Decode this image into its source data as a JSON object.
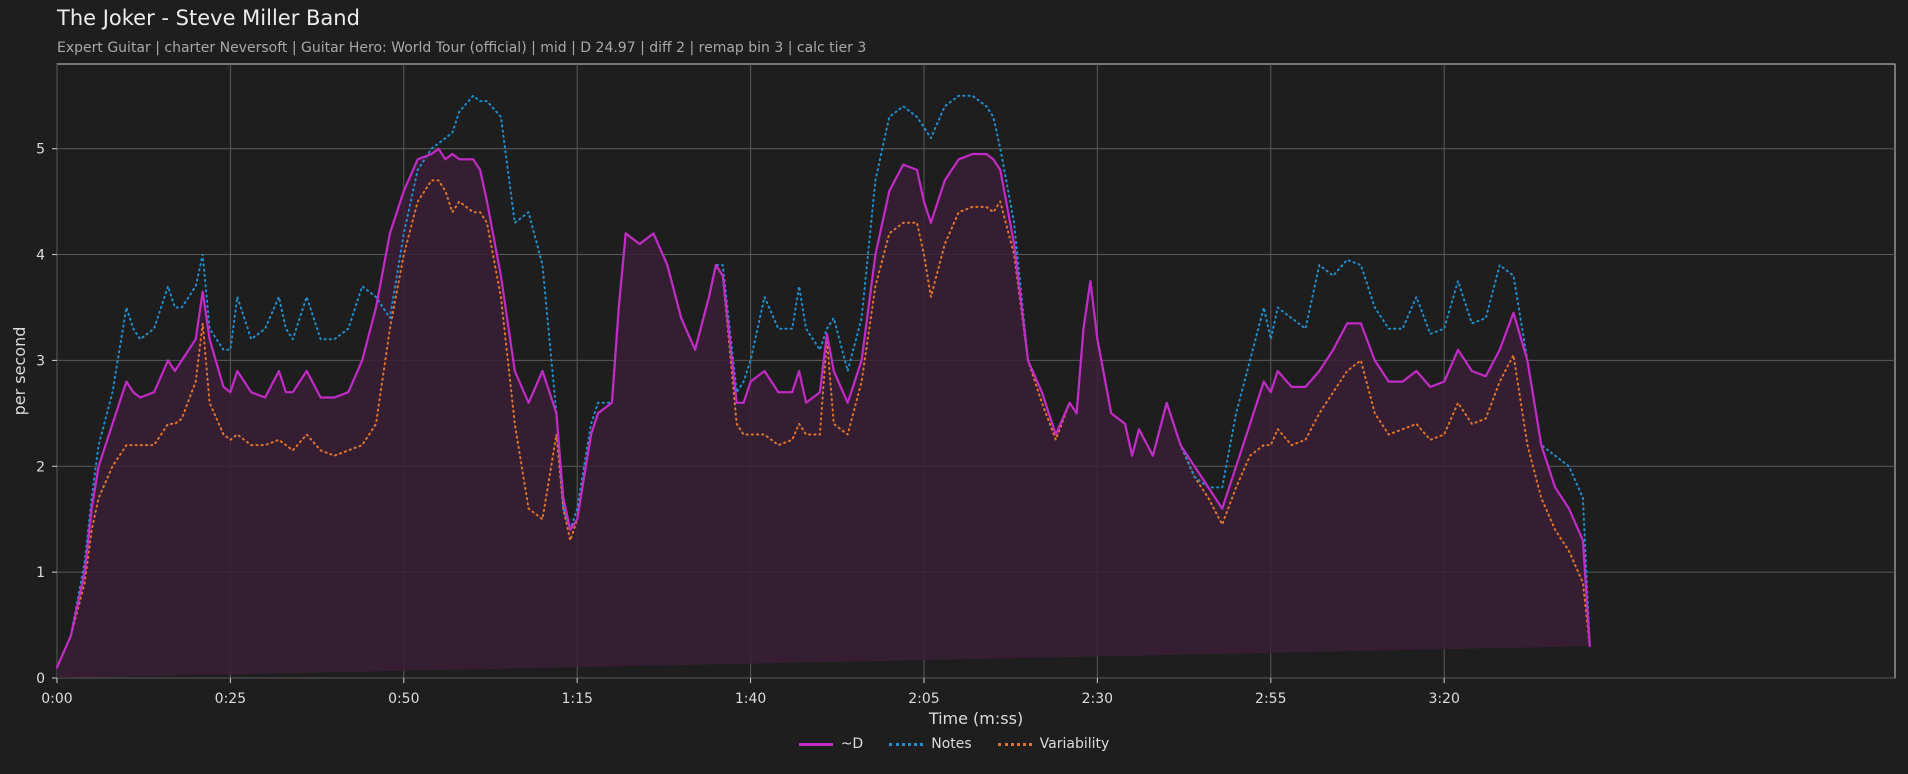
{
  "title": "The Joker - Steve Miller Band",
  "subtitle": "Expert Guitar  |  charter Neversoft  |  Guitar Hero: World Tour (official)  |  mid  |  D 24.97  |  diff 2  |  remap bin 3  |  calc tier 3",
  "colors": {
    "d": "#c22bc7",
    "notes": "#1f8fd0",
    "variability": "#e0752a",
    "fill": "#3a1f36",
    "grid": "#5a5a5a",
    "background": "#1e1e1e"
  },
  "chart_data": {
    "type": "line",
    "xlabel": "Time (m:ss)",
    "ylabel": "per second",
    "xlim": [
      0,
      265
    ],
    "ylim": [
      0,
      5.8
    ],
    "x_ticks": [
      0,
      25,
      50,
      75,
      100,
      125,
      150,
      175,
      200
    ],
    "x_tick_labels": [
      "0:00",
      "0:25",
      "0:50",
      "1:15",
      "1:40",
      "2:05",
      "2:30",
      "2:55",
      "3:20"
    ],
    "y_ticks": [
      0,
      1,
      2,
      3,
      4,
      5
    ],
    "y_tick_labels": [
      "0",
      "1",
      "2",
      "3",
      "4",
      "5"
    ],
    "grid": true,
    "legend_position": "bottom-center",
    "x": [
      0,
      2,
      4,
      5,
      6,
      8,
      10,
      11,
      12,
      14,
      16,
      17,
      18,
      20,
      21,
      22,
      24,
      25,
      26,
      28,
      30,
      32,
      33,
      34,
      36,
      38,
      40,
      42,
      44,
      46,
      48,
      50,
      52,
      54,
      55,
      56,
      57,
      58,
      60,
      61,
      62,
      64,
      66,
      68,
      70,
      72,
      73,
      74,
      75,
      76,
      77,
      78,
      80,
      81,
      82,
      84,
      86,
      88,
      90,
      92,
      94,
      95,
      96,
      98,
      99,
      100,
      102,
      104,
      106,
      107,
      108,
      110,
      111,
      112,
      114,
      116,
      118,
      120,
      122,
      124,
      125,
      126,
      128,
      130,
      132,
      134,
      135,
      136,
      138,
      140,
      142,
      144,
      146,
      147,
      148,
      149,
      150,
      152,
      154,
      155,
      156,
      158,
      160,
      162,
      164,
      166,
      168,
      170,
      172,
      174,
      175,
      176,
      178,
      180,
      182,
      184,
      186,
      188,
      190,
      192,
      194,
      196,
      198,
      200,
      202,
      204,
      206,
      208,
      210,
      212,
      214,
      216,
      218,
      220,
      221,
      222,
      223,
      224,
      226
    ],
    "series": [
      {
        "name": "~D",
        "style": "solid",
        "values": [
          0.1,
          0.4,
          1.0,
          1.6,
          2.0,
          2.4,
          2.8,
          2.7,
          2.65,
          2.7,
          3.0,
          2.9,
          3.0,
          3.2,
          3.65,
          3.2,
          2.75,
          2.7,
          2.9,
          2.7,
          2.65,
          2.9,
          2.7,
          2.7,
          2.9,
          2.65,
          2.65,
          2.7,
          3.0,
          3.5,
          4.2,
          4.6,
          4.9,
          4.95,
          5.0,
          4.9,
          4.95,
          4.9,
          4.9,
          4.8,
          4.5,
          3.8,
          2.9,
          2.6,
          2.9,
          2.5,
          1.7,
          1.4,
          1.5,
          1.9,
          2.3,
          2.5,
          2.6,
          3.5,
          4.2,
          4.1,
          4.2,
          3.9,
          3.4,
          3.1,
          3.6,
          3.9,
          3.8,
          2.6,
          2.6,
          2.8,
          2.9,
          2.7,
          2.7,
          2.9,
          2.6,
          2.7,
          3.25,
          2.9,
          2.6,
          3.0,
          4.0,
          4.6,
          4.85,
          4.8,
          4.5,
          4.3,
          4.7,
          4.9,
          4.95,
          4.95,
          4.9,
          4.8,
          4.1,
          3.0,
          2.7,
          2.3,
          2.6,
          2.5,
          3.3,
          3.75,
          3.2,
          2.5,
          2.4,
          2.1,
          2.35,
          2.1,
          2.6,
          2.2,
          2.0,
          1.8,
          1.6,
          2.0,
          2.4,
          2.8,
          2.7,
          2.9,
          2.75,
          2.75,
          2.9,
          3.1,
          3.35,
          3.35,
          3.0,
          2.8,
          2.8,
          2.9,
          2.75,
          2.8,
          3.1,
          2.9,
          2.85,
          3.1,
          3.45,
          3.0,
          2.2,
          1.8,
          1.6,
          1.3,
          0.3
        ]
      },
      {
        "name": "Notes",
        "style": "dotted",
        "values": [
          0.1,
          0.4,
          1.1,
          1.7,
          2.2,
          2.7,
          3.5,
          3.3,
          3.2,
          3.3,
          3.7,
          3.5,
          3.5,
          3.7,
          4.0,
          3.3,
          3.1,
          3.1,
          3.6,
          3.2,
          3.3,
          3.6,
          3.3,
          3.2,
          3.6,
          3.2,
          3.2,
          3.3,
          3.7,
          3.6,
          3.4,
          4.2,
          4.8,
          5.0,
          5.05,
          5.1,
          5.15,
          5.35,
          5.5,
          5.45,
          5.45,
          5.3,
          4.3,
          4.4,
          3.9,
          2.5,
          1.6,
          1.4,
          1.6,
          2.0,
          2.4,
          2.6,
          2.6,
          3.5,
          4.2,
          4.1,
          4.2,
          3.9,
          3.4,
          3.1,
          3.6,
          3.9,
          3.9,
          2.7,
          2.8,
          3.0,
          3.6,
          3.3,
          3.3,
          3.7,
          3.3,
          3.1,
          3.3,
          3.4,
          2.9,
          3.4,
          4.7,
          5.3,
          5.4,
          5.3,
          5.2,
          5.1,
          5.4,
          5.5,
          5.5,
          5.4,
          5.3,
          5.0,
          4.3,
          3.0,
          2.7,
          2.3,
          2.6,
          2.5,
          3.3,
          3.75,
          3.2,
          2.5,
          2.4,
          2.1,
          2.35,
          2.1,
          2.6,
          2.2,
          1.9,
          1.8,
          1.8,
          2.5,
          3.0,
          3.5,
          3.2,
          3.5,
          3.4,
          3.3,
          3.9,
          3.8,
          3.95,
          3.9,
          3.5,
          3.3,
          3.3,
          3.6,
          3.25,
          3.3,
          3.75,
          3.35,
          3.4,
          3.9,
          3.8,
          3.0,
          2.2,
          2.1,
          2.0,
          1.7,
          0.3
        ]
      },
      {
        "name": "Variability",
        "style": "dotted",
        "values": [
          0.1,
          0.4,
          0.9,
          1.4,
          1.7,
          2.0,
          2.2,
          2.2,
          2.2,
          2.2,
          2.4,
          2.4,
          2.45,
          2.8,
          3.35,
          2.6,
          2.3,
          2.25,
          2.3,
          2.2,
          2.2,
          2.25,
          2.2,
          2.15,
          2.3,
          2.15,
          2.1,
          2.15,
          2.2,
          2.4,
          3.3,
          4.0,
          4.5,
          4.7,
          4.7,
          4.6,
          4.4,
          4.5,
          4.4,
          4.4,
          4.3,
          3.6,
          2.4,
          1.6,
          1.5,
          2.3,
          1.6,
          1.3,
          1.5,
          1.9,
          2.3,
          2.5,
          2.6,
          3.5,
          4.2,
          4.1,
          4.2,
          3.9,
          3.4,
          3.1,
          3.6,
          3.9,
          3.8,
          2.4,
          2.3,
          2.3,
          2.3,
          2.2,
          2.25,
          2.4,
          2.3,
          2.3,
          3.2,
          2.4,
          2.3,
          2.8,
          3.7,
          4.2,
          4.3,
          4.3,
          4.0,
          3.6,
          4.1,
          4.4,
          4.45,
          4.45,
          4.4,
          4.5,
          4.0,
          3.0,
          2.6,
          2.25,
          2.6,
          2.5,
          3.3,
          3.75,
          3.2,
          2.5,
          2.4,
          2.1,
          2.35,
          2.1,
          2.6,
          2.2,
          1.9,
          1.7,
          1.45,
          1.8,
          2.1,
          2.2,
          2.2,
          2.35,
          2.2,
          2.25,
          2.5,
          2.7,
          2.9,
          3.0,
          2.5,
          2.3,
          2.35,
          2.4,
          2.25,
          2.3,
          2.6,
          2.4,
          2.45,
          2.8,
          3.05,
          2.2,
          1.7,
          1.4,
          1.2,
          0.9,
          0.3
        ]
      }
    ]
  },
  "legend": [
    {
      "label": "~D",
      "style": "solid",
      "color": "#c22bc7"
    },
    {
      "label": "Notes",
      "style": "dotted",
      "color": "#1f8fd0"
    },
    {
      "label": "Variability",
      "style": "dotted",
      "color": "#e0752a"
    }
  ]
}
